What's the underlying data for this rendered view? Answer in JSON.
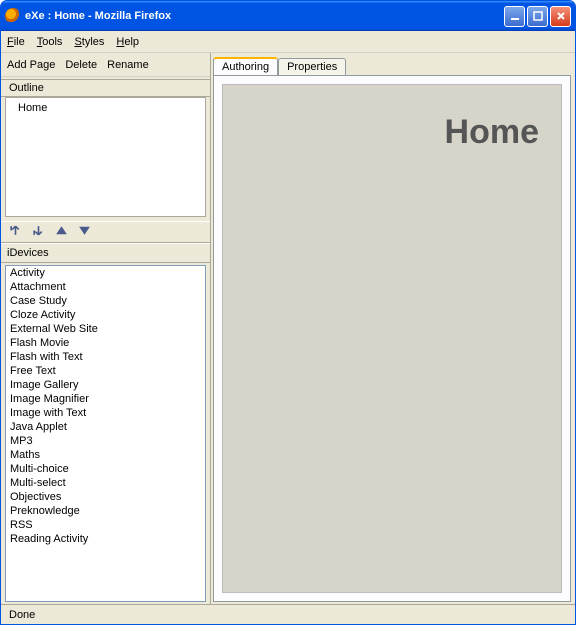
{
  "window": {
    "title": "eXe : Home - Mozilla Firefox"
  },
  "menubar": {
    "file": "File",
    "tools": "Tools",
    "styles": "Styles",
    "help": "Help"
  },
  "toolbar": {
    "add": "Add Page",
    "delete": "Delete",
    "rename": "Rename"
  },
  "outline": {
    "header": "Outline",
    "root": "Home"
  },
  "idevices": {
    "header": "iDevices",
    "items": [
      "Activity",
      "Attachment",
      "Case Study",
      "Cloze Activity",
      "External Web Site",
      "Flash Movie",
      "Flash with Text",
      "Free Text",
      "Image Gallery",
      "Image Magnifier",
      "Image with Text",
      "Java Applet",
      "MP3",
      "Maths",
      "Multi-choice",
      "Multi-select",
      "Objectives",
      "Preknowledge",
      "RSS",
      "Reading Activity"
    ]
  },
  "tabs": {
    "authoring": "Authoring",
    "properties": "Properties"
  },
  "content": {
    "heading": "Home"
  },
  "status": {
    "text": "Done"
  }
}
